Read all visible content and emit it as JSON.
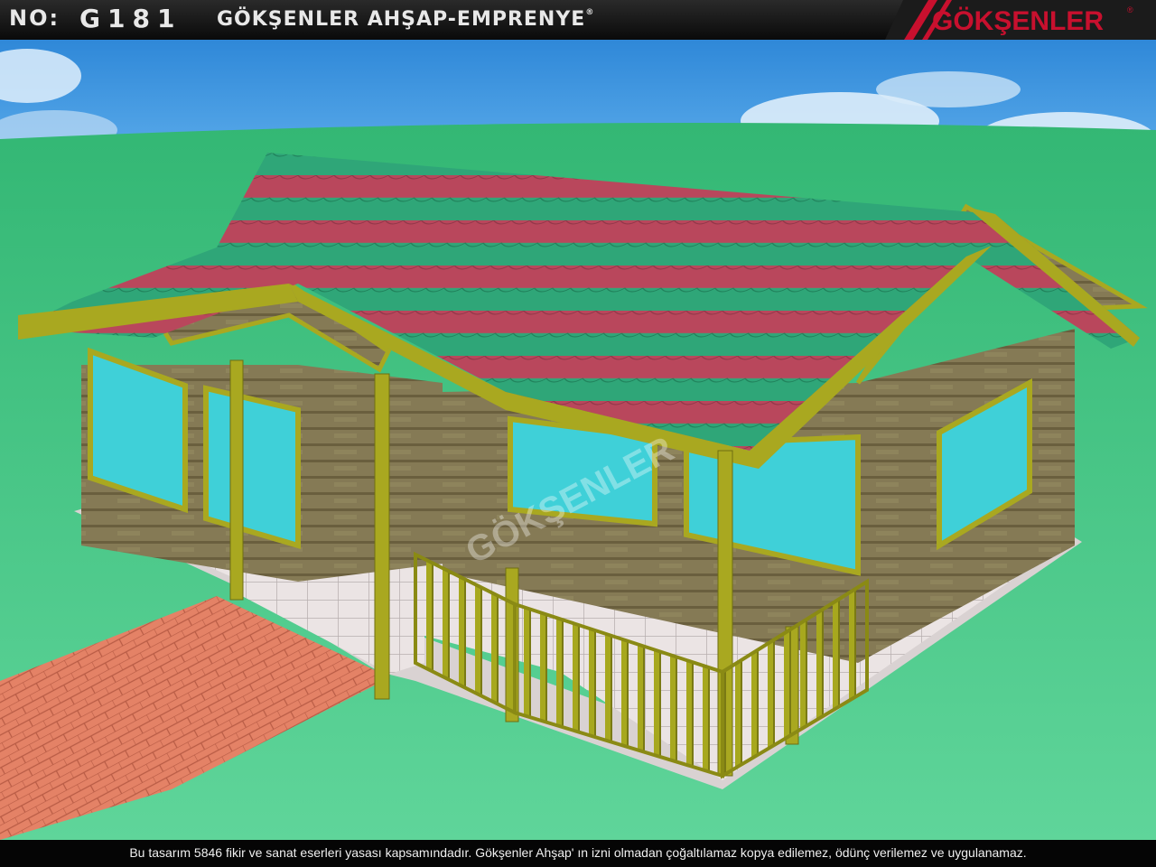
{
  "header": {
    "no_label": "NO:",
    "no_value": "G181",
    "company": "GÖKŞENLER AHŞAP-EMPRENYE",
    "registered": "®",
    "logo_text": "GÖKŞENLER",
    "logo_registered": "®"
  },
  "watermark": {
    "text": "GÖKŞENLER",
    "registered": "®"
  },
  "footer": {
    "notice": "Bu tasarım 5846 fikir ve sanat eserleri yasası kapsamındadır. Gökşenler Ahşap' ın izni olmadan çoğaltılamaz kopya edilemez, ödünç verilemez ve uygulanamaz."
  },
  "colors": {
    "sky": "#3d95e0",
    "grass": "#5cd396",
    "roof_red": "#b9475c",
    "roof_green": "#2fa678",
    "wood": "#8a7d4e",
    "frame": "#a9a820",
    "glass": "#3fd0d8",
    "path": "#e07e63",
    "accent_red": "#c8102e"
  }
}
